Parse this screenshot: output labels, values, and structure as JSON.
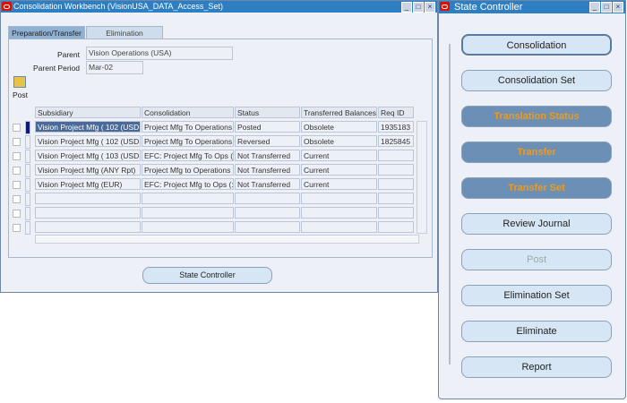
{
  "main": {
    "title": "Consolidation Workbench (VisionUSA_DATA_Access_Set)",
    "tabs": [
      "Preparation/Transfer",
      "Elimination"
    ],
    "parent_label": "Parent",
    "parent_value": "Vision Operations (USA)",
    "period_label": "Parent Period",
    "period_value": "Mar-02",
    "post_label": "Post",
    "columns": [
      "Subsidiary",
      "Consolidation",
      "Status",
      "Transferred Balances",
      "Req ID"
    ],
    "rows": [
      [
        "Vision Project Mfg ( 102 (USD",
        "Project Mfg To Operations",
        "Posted",
        "Obsolete",
        "1935183"
      ],
      [
        "Vision Project Mfg ( 102 (USD",
        "Project Mfg To Operations",
        "Reversed",
        "Obsolete",
        "1825845"
      ],
      [
        "Vision Project Mfg ( 103 (USD",
        "EFC: Project Mfg To Ops (",
        "Not Transferred",
        "Current",
        ""
      ],
      [
        "Vision Project Mfg (ANY Rpt)",
        "Project Mfg to Operations",
        "Not Transferred",
        "Current",
        ""
      ],
      [
        "Vision Project Mfg (EUR)",
        "EFC: Project Mfg to Ops (:",
        "Not Transferred",
        "Current",
        ""
      ],
      [
        "",
        "",
        "",
        "",
        ""
      ],
      [
        "",
        "",
        "",
        "",
        ""
      ],
      [
        "",
        "",
        "",
        "",
        ""
      ]
    ],
    "state_controller_button": "State Controller"
  },
  "state": {
    "title": "State Controller",
    "buttons": [
      {
        "label": "Consolidation",
        "style": "normal"
      },
      {
        "label": "Consolidation Set",
        "style": "normal"
      },
      {
        "label": "Translation Status",
        "style": "dark"
      },
      {
        "label": "Transfer",
        "style": "dark"
      },
      {
        "label": "Transfer Set",
        "style": "dark"
      },
      {
        "label": "Review Journal",
        "style": "normal"
      },
      {
        "label": "Post",
        "style": "disabled"
      },
      {
        "label": "Elimination Set",
        "style": "normal"
      },
      {
        "label": "Eliminate",
        "style": "normal"
      },
      {
        "label": "Report",
        "style": "normal"
      }
    ]
  }
}
